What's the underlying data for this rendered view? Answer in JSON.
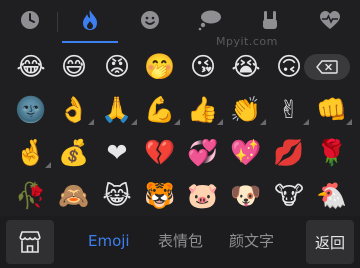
{
  "category_tabs": [
    {
      "icon": "clock-icon",
      "glyph": "🕓",
      "active": false
    },
    {
      "icon": "flame-icon",
      "glyph": "🔥",
      "active": true
    },
    {
      "icon": "smiley-icon",
      "glyph": "☺",
      "active": false
    },
    {
      "icon": "thought-bubble-icon",
      "glyph": "💭",
      "active": false
    },
    {
      "icon": "rock-hand-icon",
      "glyph": "🤘",
      "active": false
    },
    {
      "icon": "heartbeat-icon",
      "glyph": "💓",
      "active": false
    }
  ],
  "watermark": "Mpyit.com",
  "emoji_rows": [
    [
      {
        "char": "😂",
        "more": false
      },
      {
        "char": "😅",
        "more": false
      },
      {
        "char": "😡",
        "more": false
      },
      {
        "char": "🤭",
        "more": false
      },
      {
        "char": "😘",
        "more": false
      },
      {
        "char": "😭",
        "more": false
      },
      {
        "char": "🙃",
        "more": false
      }
    ],
    [
      {
        "char": "🌚",
        "more": false
      },
      {
        "char": "👌",
        "more": true
      },
      {
        "char": "🙏",
        "more": true
      },
      {
        "char": "💪",
        "more": true
      },
      {
        "char": "👍",
        "more": true
      },
      {
        "char": "👏",
        "more": true
      },
      {
        "char": "✌",
        "more": true
      },
      {
        "char": "👊",
        "more": true
      }
    ],
    [
      {
        "char": "🤞",
        "more": true
      },
      {
        "char": "💰",
        "more": false
      },
      {
        "char": "❤",
        "more": false
      },
      {
        "char": "💔",
        "more": false
      },
      {
        "char": "💞",
        "more": false
      },
      {
        "char": "💖",
        "more": false
      },
      {
        "char": "💋",
        "more": false
      },
      {
        "char": "🌹",
        "more": false
      }
    ],
    [
      {
        "char": "🥀",
        "more": false
      },
      {
        "char": "🙈",
        "more": false
      },
      {
        "char": "😹",
        "more": false
      },
      {
        "char": "🐯",
        "more": false
      },
      {
        "char": "🐷",
        "more": false
      },
      {
        "char": "🐶",
        "more": false
      },
      {
        "char": "🐮",
        "more": false
      },
      {
        "char": "🐔",
        "more": false
      }
    ]
  ],
  "bottom_bar": {
    "store_icon": "store-icon",
    "tabs": [
      {
        "label": "Emoji",
        "active": true
      },
      {
        "label": "表情包",
        "active": false
      },
      {
        "label": "颜文字",
        "active": false
      }
    ],
    "back_label": "返回"
  },
  "colors": {
    "accent": "#3d7ff0",
    "background": "#1f1f21",
    "inactive_icon": "#8e8e93"
  }
}
